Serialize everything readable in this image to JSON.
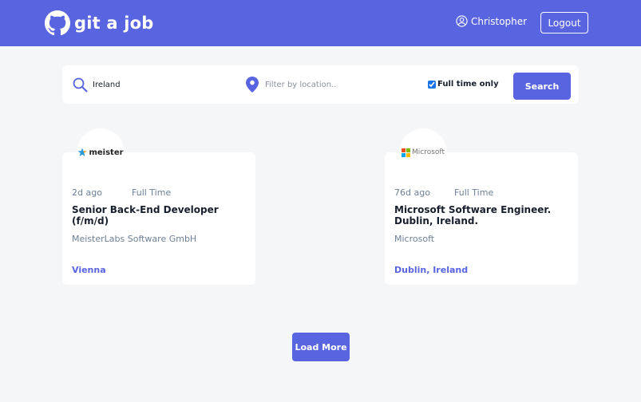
{
  "header": {
    "brand": "git a job",
    "user_name": "Christopher",
    "logout_label": "Logout"
  },
  "search": {
    "query_value": "Ireland",
    "location_placeholder": "Filter by location..",
    "location_value": "",
    "fulltime_label": "Full time only",
    "fulltime_checked": true,
    "button_label": "Search"
  },
  "jobs": [
    {
      "posted": "2d ago",
      "type": "Full Time",
      "title": "Senior Back-End Developer (f/m/d)",
      "company": "MeisterLabs Software GmbH",
      "location": "Vienna",
      "logo_text": "meister"
    },
    {
      "posted": "76d ago",
      "type": "Full Time",
      "title": "Microsoft Software Engineer. Dublin, Ireland.",
      "company": "Microsoft",
      "location": "Dublin, Ireland",
      "logo_text": "Microsoft"
    }
  ],
  "load_more_label": "Load More",
  "colors": {
    "brand": "#5964e0",
    "background": "#f4f6f8",
    "text_dark": "#19202d",
    "text_muted": "#6e8098"
  }
}
